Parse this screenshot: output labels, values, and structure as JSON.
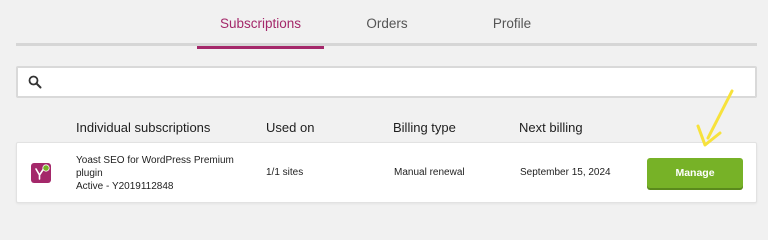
{
  "tabs": [
    {
      "label": "Subscriptions",
      "active": true
    },
    {
      "label": "Orders",
      "active": false
    },
    {
      "label": "Profile",
      "active": false
    }
  ],
  "search": {
    "value": "",
    "placeholder": "",
    "icon": "search-icon"
  },
  "table": {
    "columns": [
      "Individual subscriptions",
      "Used on",
      "Billing type",
      "Next billing"
    ],
    "rows": [
      {
        "icon": "yoast-logo-icon",
        "name": "Yoast SEO for WordPress Premium plugin",
        "status": "Active - Y2019112848",
        "used_on": "1/1 sites",
        "billing_type": "Manual renewal",
        "next_billing": "September 15, 2024",
        "action_label": "Manage"
      }
    ]
  },
  "colors": {
    "accent": "#a4286a",
    "button": "#77b227",
    "arrow": "#f7e23c"
  }
}
